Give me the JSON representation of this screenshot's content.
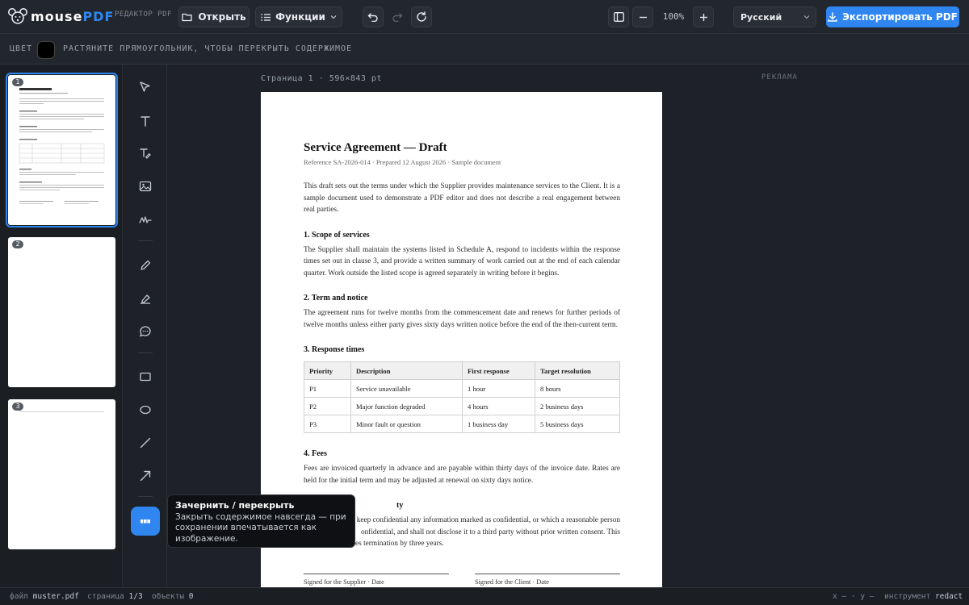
{
  "app": {
    "name_part1": "mouse",
    "name_part2": "PDF",
    "subtitle": "РЕДАКТОР PDF",
    "accent_color": "#2f86f0"
  },
  "toolbar": {
    "open_label": "Открыть",
    "functions_label": "Функции",
    "zoom_level": "100%",
    "language": "Русский",
    "export_label": "Экспортировать PDF"
  },
  "subbar": {
    "color_label": "ЦВЕТ",
    "color_value": "#000000",
    "hint": "РАСТЯНИТЕ ПРЯМОУГОЛЬНИК, ЧТОБЫ ПЕРЕКРЫТЬ СОДЕРЖИМОЕ"
  },
  "thumbnails": [
    {
      "number": "1",
      "active": true
    },
    {
      "number": "2",
      "active": false
    },
    {
      "number": "3",
      "active": false
    }
  ],
  "tools": [
    "select-icon",
    "text-icon",
    "text-edit-icon",
    "image-icon",
    "signature-icon",
    "pencil-icon",
    "highlighter-icon",
    "comment-icon",
    "rectangle-icon",
    "ellipse-icon",
    "line-icon",
    "arrow-icon",
    "redact-icon"
  ],
  "canvas": {
    "page_caption": "Страница 1 · 596×843 pt",
    "ads_label": "РЕКЛАМА"
  },
  "document": {
    "title": "Service Agreement — Draft",
    "reference": "Reference SA-2026-014 · Prepared 12 August 2026 · Sample document",
    "intro": "This draft sets out the terms under which the Supplier provides maintenance services to the Client. It is a sample document used to demonstrate a PDF editor and does not describe a real engagement between real parties.",
    "s1_title": "1. Scope of services",
    "s1_body": "The Supplier shall maintain the systems listed in Schedule A, respond to incidents within the response times set out in clause 3, and provide a written summary of work carried out at the end of each calendar quarter. Work outside the listed scope is agreed separately in writing before it begins.",
    "s2_title": "2. Term and notice",
    "s2_body": "The agreement runs for twelve months from the commencement date and renews for further periods of twelve months unless either party gives sixty days written notice before the end of the then-current term.",
    "s3_title": "3. Response times",
    "table": {
      "headers": [
        "Priority",
        "Description",
        "First response",
        "Target resolution"
      ],
      "rows": [
        [
          "P1",
          "Service unavailable",
          "1 hour",
          "8 hours"
        ],
        [
          "P2",
          "Major function degraded",
          "4 hours",
          "2 business days"
        ],
        [
          "P3",
          "Minor fault or question",
          "1 business day",
          "5 business days"
        ]
      ]
    },
    "s4_title": "4. Fees",
    "s4_body": "Fees are invoiced quarterly in advance and are payable within thirty days of the invoice date. Rates are held for the initial term and may be adjusted at renewal on sixty days notice.",
    "s5_title_visible": "ty",
    "s5_line1": "keep confidential any information marked as confidential, or which a reasonable person",
    "s5_line2": "onfidential, and shall not disclose it to a third party without prior written consent. This",
    "s5_line3": "es termination by three years.",
    "sig_supplier": "Signed for the Supplier · Date",
    "sig_client": "Signed for the Client · Date"
  },
  "tooltip": {
    "title": "Зачернить / перекрыть",
    "body": "Закрыть содержимое навсегда — при сохранении впечатывается как изображение."
  },
  "status": {
    "file_label": "файл",
    "file_value": "muster.pdf",
    "page_label": "страница",
    "page_value": "1/3",
    "objects_label": "объекты",
    "objects_value": "0",
    "coords": "x — · y —",
    "tool_label": "инструмент",
    "tool_value": "redact"
  }
}
